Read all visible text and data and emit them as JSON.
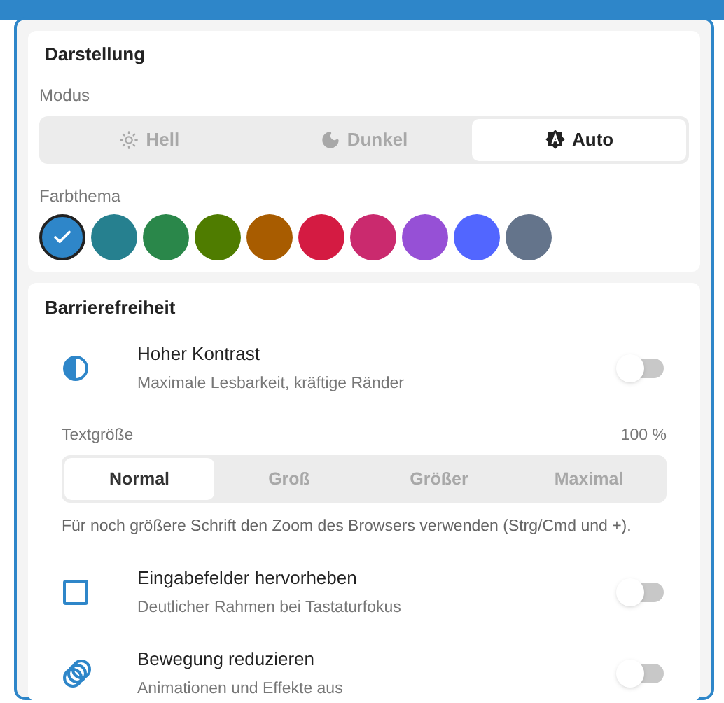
{
  "appearance": {
    "title": "Darstellung",
    "mode_label": "Modus",
    "modes": [
      {
        "kind": "light",
        "label": "Hell",
        "selected": false
      },
      {
        "kind": "dark",
        "label": "Dunkel",
        "selected": false
      },
      {
        "kind": "auto",
        "label": "Auto",
        "selected": true
      }
    ],
    "theme_label": "Farbthema",
    "themes": [
      {
        "color": "#2e86c9",
        "selected": true
      },
      {
        "color": "#26808f",
        "selected": false
      },
      {
        "color": "#2a874a",
        "selected": false
      },
      {
        "color": "#4f7c00",
        "selected": false
      },
      {
        "color": "#a85c00",
        "selected": false
      },
      {
        "color": "#d41b42",
        "selected": false
      },
      {
        "color": "#ca2a6e",
        "selected": false
      },
      {
        "color": "#9650d6",
        "selected": false
      },
      {
        "color": "#5266ff",
        "selected": false
      },
      {
        "color": "#64748b",
        "selected": false
      }
    ]
  },
  "accessibility": {
    "title": "Barrierefreiheit",
    "contrast": {
      "kind": "contrast",
      "title": "Hoher Kontrast",
      "subtitle": "Maximale Lesbarkeit, kräftige Ränder",
      "on": false
    },
    "text_size_label": "Textgröße",
    "text_size_value": "100 %",
    "text_sizes": [
      {
        "label": "Normal",
        "selected": true
      },
      {
        "label": "Groß",
        "selected": false
      },
      {
        "label": "Größer",
        "selected": false
      },
      {
        "label": "Maximal",
        "selected": false
      }
    ],
    "hint": "Für noch größere Schrift den Zoom des Browsers verwenden (Strg/Cmd und +).",
    "toggles": [
      {
        "kind": "focus",
        "title": "Eingabefelder hervorheben",
        "subtitle": "Deutlicher Rahmen bei Tastaturfokus",
        "on": false
      },
      {
        "kind": "motion",
        "title": "Bewegung reduzieren",
        "subtitle": "Animationen und Effekte aus",
        "on": false
      }
    ]
  }
}
